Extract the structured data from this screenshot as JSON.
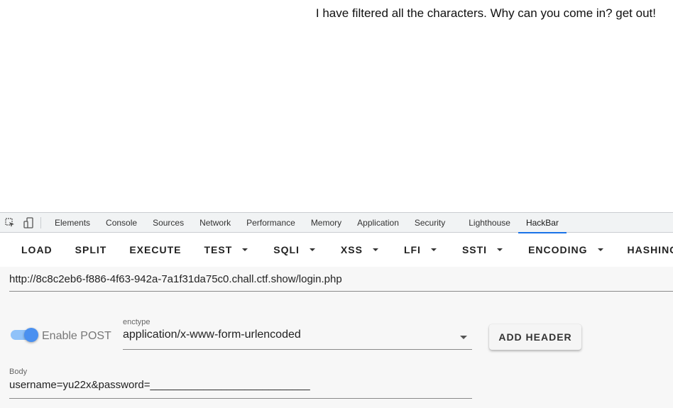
{
  "page": {
    "message": "I have filtered all the characters. Why can you come in? get out!"
  },
  "devtools": {
    "icons": {
      "inspect": "inspect-element-icon",
      "device": "device-toolbar-icon"
    },
    "tabs": [
      {
        "label": "Elements"
      },
      {
        "label": "Console"
      },
      {
        "label": "Sources"
      },
      {
        "label": "Network"
      },
      {
        "label": "Performance"
      },
      {
        "label": "Memory"
      },
      {
        "label": "Application"
      },
      {
        "label": "Security"
      },
      {
        "label": "Lighthouse"
      },
      {
        "label": "HackBar",
        "active": true
      }
    ],
    "accent": "#1a73e8"
  },
  "hackbar": {
    "buttons": {
      "load": "LOAD",
      "split": "SPLIT",
      "execute": "EXECUTE",
      "test": "TEST",
      "sqli": "SQLI",
      "xss": "XSS",
      "lfi": "LFI",
      "ssti": "SSTI",
      "encoding": "ENCODING",
      "hashing": "HASHING"
    },
    "url": "http://8c8c2eb6-f886-4f63-942a-7a1f31da75c0.chall.ctf.show/login.php",
    "post": {
      "enabled": true,
      "label": "Enable POST"
    },
    "enctype": {
      "label": "enctype",
      "value": "application/x-www-form-urlencoded"
    },
    "add_header": "ADD HEADER",
    "body": {
      "label": "Body",
      "value": "username=yu22x&password=___________________________"
    }
  }
}
